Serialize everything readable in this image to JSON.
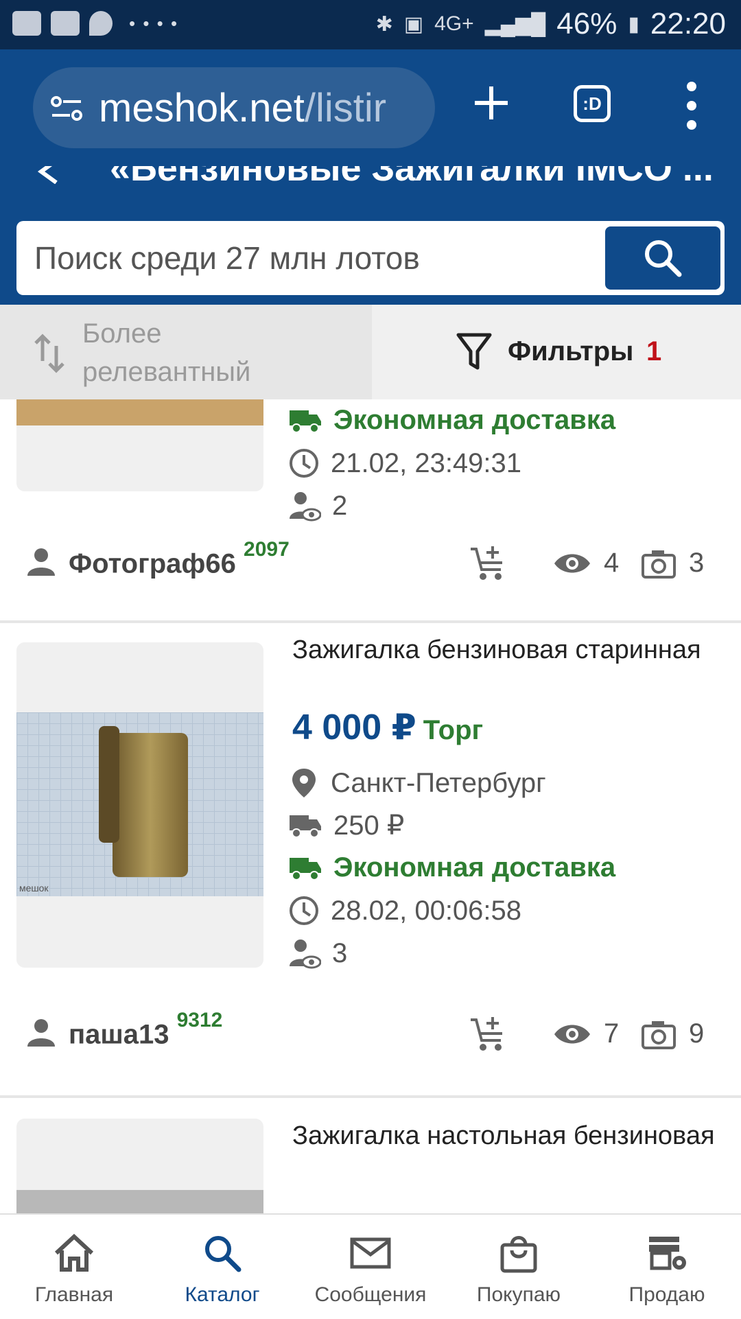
{
  "status_bar": {
    "network": "4G+",
    "battery": "46%",
    "time": "22:20"
  },
  "browser": {
    "url_host": "meshok.net",
    "url_path": "/listir",
    "tab_label": ":D"
  },
  "page_header": {
    "title": "«Бензиновые Зажигалки IMCO ..."
  },
  "search": {
    "placeholder": "Поиск среди 27 млн лотов"
  },
  "sort": {
    "label": "Более релевантный"
  },
  "filters": {
    "label": "Фильтры",
    "count": "1"
  },
  "items": [
    {
      "delivery_label": "Экономная доставка",
      "end_time": "21.02, 23:49:31",
      "watchers": "2",
      "seller": "Фотограф66",
      "seller_rating": "2097",
      "views": "4",
      "photos": "3"
    },
    {
      "title": "Зажигалка бензиновая старинная",
      "price": "4 000 ₽",
      "bargain_label": "Торг",
      "location": "Санкт-Петербург",
      "shipping": "250 ₽",
      "delivery_label": "Экономная доставка",
      "end_time": "28.02, 00:06:58",
      "watchers": "3",
      "seller": "паша13",
      "seller_rating": "9312",
      "views": "7",
      "photos": "9",
      "watermark": "мешок"
    },
    {
      "title": "Зажигалка настольная бензиновая"
    }
  ],
  "bottom_nav": {
    "items": [
      {
        "label": "Главная"
      },
      {
        "label": "Каталог"
      },
      {
        "label": "Сообщения"
      },
      {
        "label": "Покупаю"
      },
      {
        "label": "Продаю"
      }
    ],
    "active_index": 1
  },
  "colors": {
    "brand_blue": "#0f4a8a",
    "status_bar": "#0b2a4f",
    "green": "#2e7d32",
    "badge_red": "#c0121a"
  }
}
